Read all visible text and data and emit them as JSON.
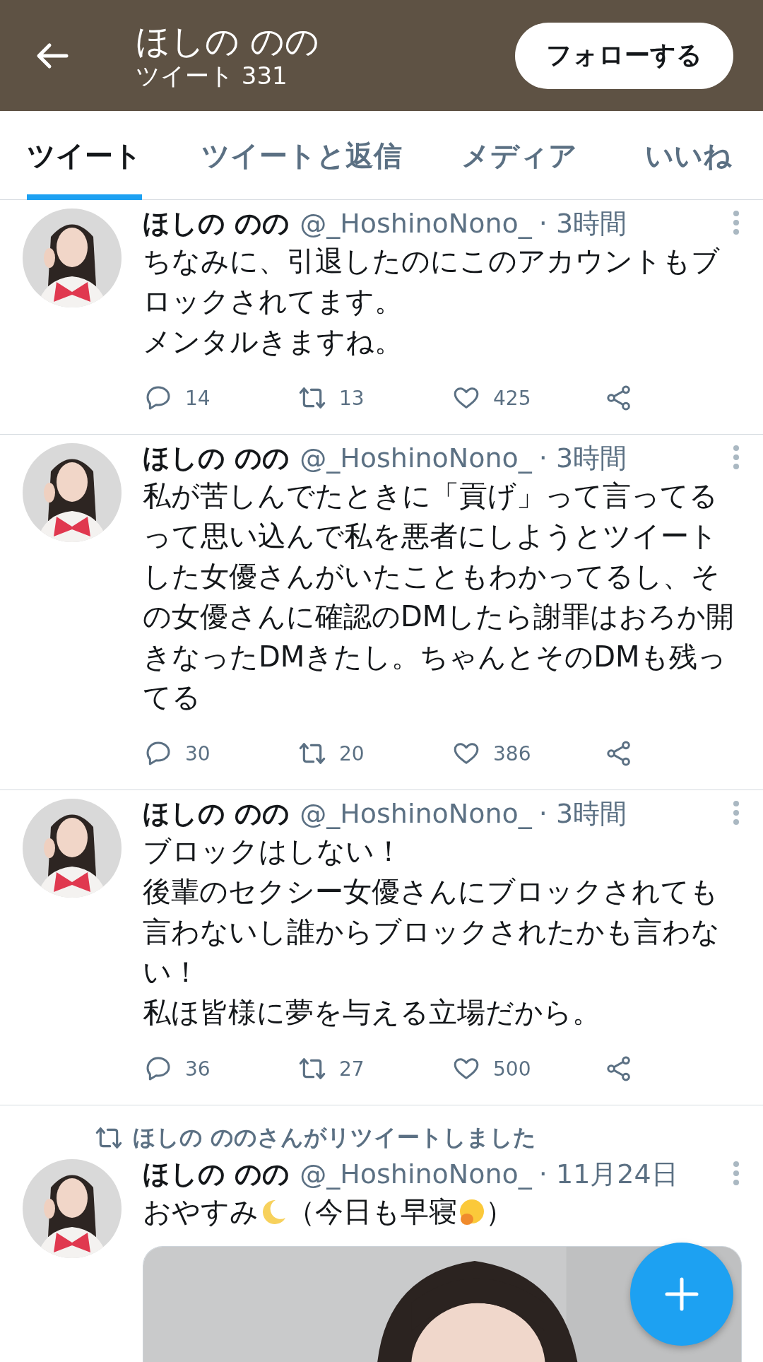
{
  "header": {
    "title": "ほしの のの",
    "subtitle": "ツイート 331",
    "follow_button": "フォローする"
  },
  "tabs": [
    {
      "label": "ツイート",
      "selected": true
    },
    {
      "label": "ツイートと返信",
      "selected": false
    },
    {
      "label": "メディア",
      "selected": false
    },
    {
      "label": "いいね",
      "selected": false
    }
  ],
  "tweets": [
    {
      "name": "ほしの のの",
      "handle": "@_HoshinoNono_",
      "time": "· 3時間",
      "body": [
        {
          "kind": "line",
          "text": "ちなみに、引退したのにこのアカウントもブロックされてます。"
        },
        {
          "kind": "line",
          "text": "メンタルきますね。"
        }
      ],
      "replies": "14",
      "retweets": "13",
      "likes": "425"
    },
    {
      "name": "ほしの のの",
      "handle": "@_HoshinoNono_",
      "time": "· 3時間",
      "body": [
        {
          "kind": "text",
          "text": "私が苦しんでたときに「貢げ」って言ってるって思い込んで私を悪者にしようとツイートした女優さんがいたこともわかってるし、その女優さんに確認のDMしたら謝罪はおろか開きなったDMきたし。ちゃんとそのDMも残ってる"
        }
      ],
      "replies": "30",
      "retweets": "20",
      "likes": "386"
    },
    {
      "name": "ほしの のの",
      "handle": "@_HoshinoNono_",
      "time": "· 3時間",
      "body": [
        {
          "kind": "line",
          "text": "ブロックはしない！"
        },
        {
          "kind": "line",
          "text": "後輩のセクシー女優さんにブロックされても言わないし誰からブロックされたかも言わない！"
        },
        {
          "kind": "line",
          "text": "私ほ皆様に夢を与える立場だから。"
        }
      ],
      "replies": "36",
      "retweets": "27",
      "likes": "500"
    },
    {
      "retweeted_by": "ほしの ののさんがリツイートしました",
      "name": "ほしの のの",
      "handle": "@_HoshinoNono_",
      "time": "· 11月24日",
      "body": [
        {
          "kind": "text",
          "text": "おやすみ"
        },
        {
          "kind": "moon"
        },
        {
          "kind": "text",
          "text": "（今日も早寝"
        },
        {
          "kind": "yawn"
        },
        {
          "kind": "text",
          "text": "）"
        }
      ]
    }
  ]
}
